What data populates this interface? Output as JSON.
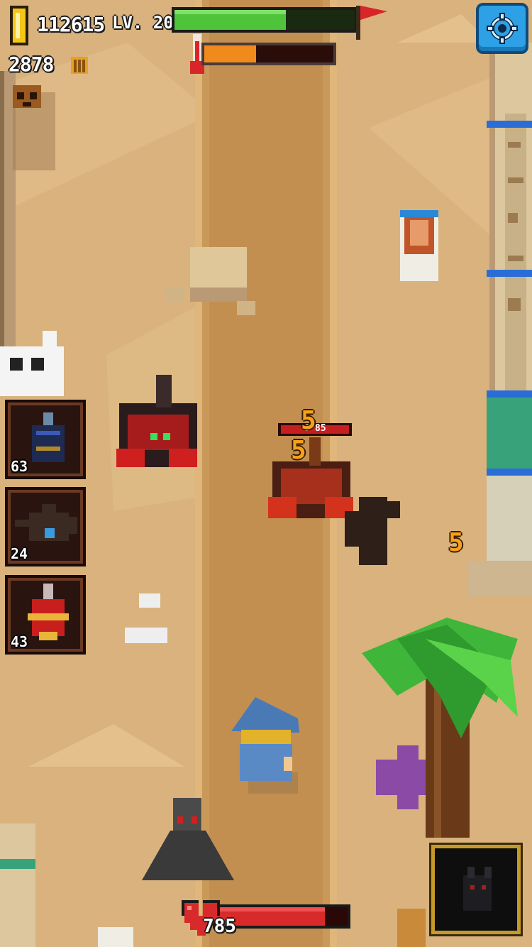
{
  "hud": {
    "gold": "112615",
    "level": "LV. 20",
    "gems": "2878",
    "level_progress": 0.62,
    "heat_progress": 0.4,
    "health_value": "785",
    "health_progress": 0.83
  },
  "enemy": {
    "hp_text": "6 85"
  },
  "inventory": [
    {
      "name": "dark-vase-potion",
      "count": "63"
    },
    {
      "name": "teapot-potion",
      "count": "24"
    },
    {
      "name": "red-potion",
      "count": "43"
    }
  ],
  "damage_numbers": [
    "5",
    "5",
    "5"
  ],
  "colors": {
    "sand": "#d9b27d",
    "road": "#c9995a",
    "progress_green": "#4fc43a",
    "heat_orange": "#f08a1c",
    "health_red": "#d82a2a",
    "settings_blue": "#2ea0e6"
  },
  "icons": {
    "coin": "coin-icon",
    "gem": "gem-icon",
    "skull": "skull-icon",
    "flag": "flag-icon",
    "thermometer": "thermometer-icon",
    "heart": "heart-icon",
    "settings": "gear-icon"
  }
}
